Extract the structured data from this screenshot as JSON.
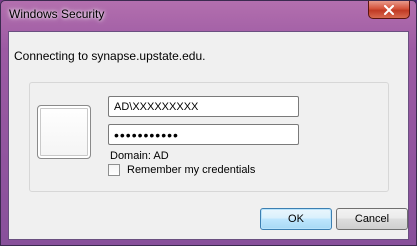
{
  "window": {
    "title": "Windows Security",
    "close_label": "x"
  },
  "prompt": "Connecting to synapse.upstate.edu.",
  "credentials": {
    "username": "AD\\XXXXXXXXX",
    "password_masked": "•••••••••••",
    "domain": "Domain: AD",
    "remember_label": "Remember my credentials",
    "remember_checked": false
  },
  "buttons": {
    "ok": "OK",
    "cancel": "Cancel"
  }
}
